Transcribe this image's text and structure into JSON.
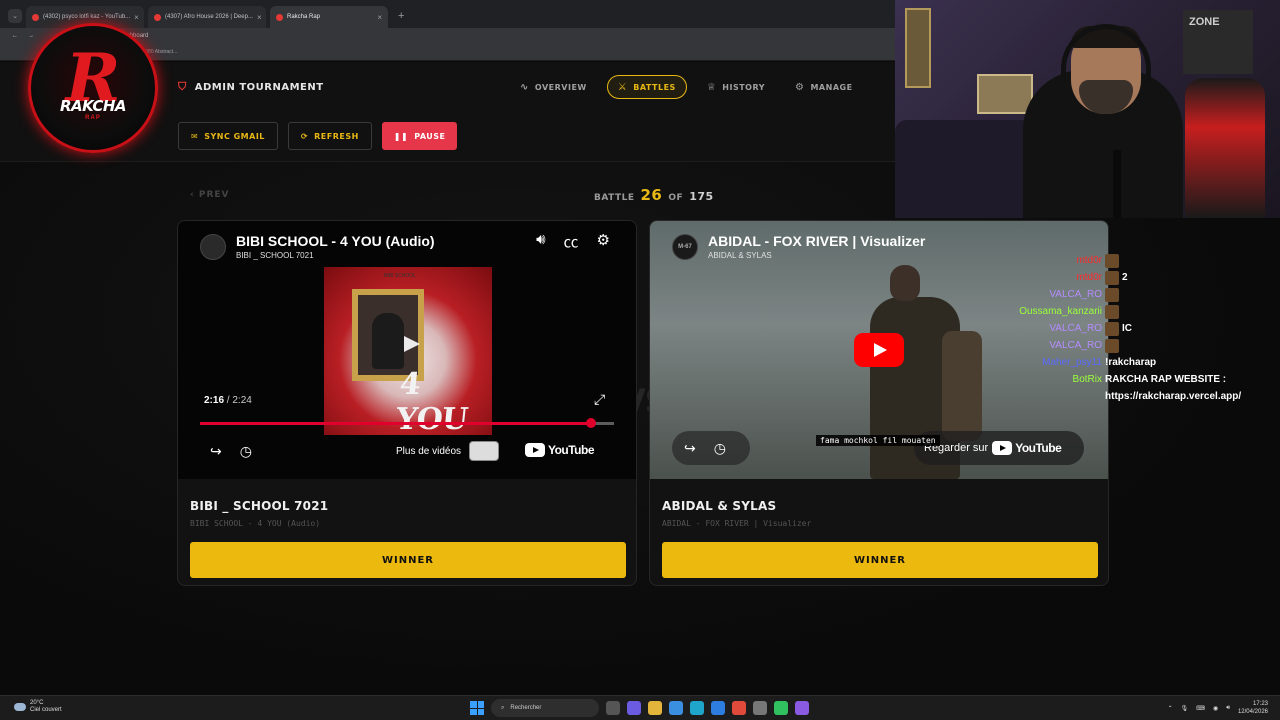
{
  "browser": {
    "tabs": [
      {
        "label": "(4302) psyco lotfi kaz - YouTub..."
      },
      {
        "label": "(4307) Afro House 2026 | Deep..."
      },
      {
        "label": "Rakcha Rap"
      }
    ],
    "new_tab": "+",
    "url": "el.app/admin/dashboard",
    "bookmark": "x1080 Abstract..."
  },
  "header": {
    "title": "ADMIN TOURNAMENT",
    "nav": [
      {
        "label": "OVERVIEW",
        "icon": "activity-icon"
      },
      {
        "label": "BATTLES",
        "icon": "swords-icon"
      },
      {
        "label": "HISTORY",
        "icon": "trophy-icon"
      },
      {
        "label": "MANAGE",
        "icon": "gear-icon"
      }
    ],
    "actions": {
      "sync": "SYNC GMAIL",
      "refresh": "REFRESH",
      "pause": "PAUSE"
    }
  },
  "battle": {
    "prev": "PREV",
    "label": "BATTLE",
    "current": "26",
    "of": "OF",
    "total": "175",
    "vs": "VS"
  },
  "left": {
    "video_title": "BIBI SCHOOL - 4 YOU (Audio)",
    "channel": "BIBI _ SCHOOL 7021",
    "cover_label": "BIBI SCHOOL",
    "cover_text": "4 YOU",
    "time_current": "2:16",
    "time_sep": " / ",
    "time_total": "2:24",
    "progress": 0.944,
    "more_videos": "Plus de vidéos",
    "youtube": "YouTube",
    "artist": "BIBI _ SCHOOL 7021",
    "track": "BIBI SCHOOL - 4 YOU (Audio)",
    "winner": "WINNER"
  },
  "right": {
    "video_title": "ABIDAL - FOX RIVER | Visualizer",
    "channel": "ABIDAL & SYLAS",
    "channel_avatar": "M-67",
    "subtitle": "fama mochkol fil mouaten",
    "watch_on": "Regarder sur",
    "youtube": "YouTube",
    "artist": "ABIDAL & SYLAS",
    "track": "ABIDAL - FOX RIVER | Visualizer",
    "winner": "WINNER"
  },
  "logo": {
    "letter": "R",
    "word": "RAKCHA",
    "sub": "RAP"
  },
  "webcam": {
    "poster": "ZONE"
  },
  "chat": [
    {
      "user": "mtd0r",
      "color": "#ff2a2a",
      "msg": ""
    },
    {
      "user": "mtd0r",
      "color": "#ff2a2a",
      "msg": "2"
    },
    {
      "user": "VALCA_RO",
      "color": "#b48cff",
      "msg": ""
    },
    {
      "user": "Oussama_kanzarii",
      "color": "#9aff3a",
      "msg": ""
    },
    {
      "user": "VALCA_RO",
      "color": "#b48cff",
      "msg": "IC"
    },
    {
      "user": "VALCA_RO",
      "color": "#b48cff",
      "msg": ""
    },
    {
      "user": "Maher_psy11",
      "color": "#5a6bff",
      "msg": "!rakcharap"
    },
    {
      "user": "BotRix",
      "color": "#9aff3a",
      "msg": "RAKCHA RAP WEBSITE :"
    },
    {
      "user": "",
      "color": "#ffffff",
      "msg": "https://rakcharap.vercel.app/"
    }
  ],
  "taskbar": {
    "temp": "20°C",
    "weather": "Ciel couvert",
    "search": "Rechercher",
    "time": "17:23",
    "date": "12/04/2026"
  },
  "colors": {
    "accent": "#e9b815",
    "danger": "#e5364a",
    "youtube_red": "#ff0000"
  }
}
